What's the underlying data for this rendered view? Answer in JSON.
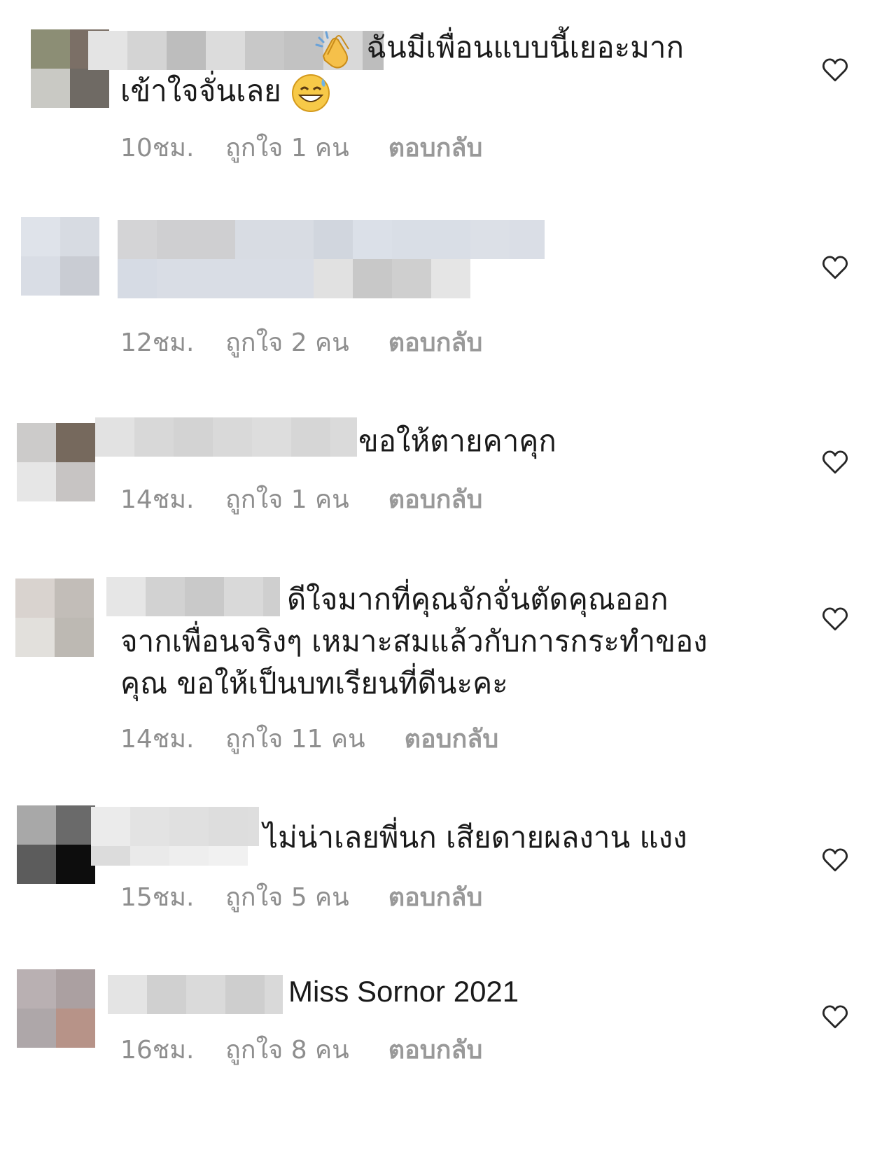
{
  "comments": [
    {
      "text_line1": "ฉันมีเพื่อนแบบนี้เยอะมาก",
      "text_line2": "เข้าใจจั่นเลย",
      "emoji1": "clapping-hands",
      "emoji2": "grinning-sweat",
      "time": "10ชม.",
      "likes": "ถูกใจ 1 คน",
      "reply": "ตอบกลับ"
    },
    {
      "text_line1": "",
      "time": "12ชม.",
      "likes": "ถูกใจ 2 คน",
      "reply": "ตอบกลับ"
    },
    {
      "text_line1": "ขอให้ตายคาคุก",
      "time": "14ชม.",
      "likes": "ถูกใจ 1 คน",
      "reply": "ตอบกลับ"
    },
    {
      "text_line1": "ดีใจมากที่คุณจักจั่นตัดคุณออก",
      "text_line2": "จากเพื่อนจริงๆ เหมาะสมแล้วกับการกระทำของ",
      "text_line3": "คุณ ขอให้เป็นบทเรียนที่ดีนะคะ",
      "time": "14ชม.",
      "likes": "ถูกใจ 11 คน",
      "reply": "ตอบกลับ"
    },
    {
      "text_line1": "ไม่น่าเลยพี่นก เสียดายผลงาน แงง",
      "time": "15ชม.",
      "likes": "ถูกใจ 5 คน",
      "reply": "ตอบกลับ"
    },
    {
      "text_line1": "Miss Sornor 2021",
      "time": "16ชม.",
      "likes": "ถูกใจ 8 คน",
      "reply": "ตอบกลับ"
    }
  ],
  "icons": {
    "like": "heart-outline-icon",
    "avatar": "pixelated-avatar",
    "username": "pixelated-username"
  },
  "colors": {
    "meta_text": "#8e8e8e",
    "comment_text": "#1a1a1a",
    "heart_stroke": "#262626"
  }
}
